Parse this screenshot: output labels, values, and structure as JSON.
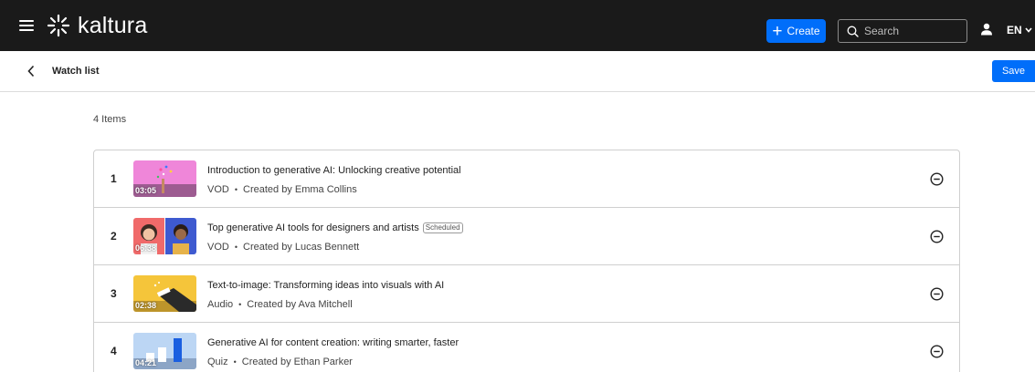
{
  "header": {
    "logo_text": "kaltura",
    "create_label": "Create",
    "search_placeholder": "Search",
    "language": "EN",
    "accent_color": "#006efa",
    "icons": [
      "hamburger-icon",
      "kaltura-logo-icon",
      "plus-icon",
      "search-icon",
      "user-icon",
      "chevron-down-icon"
    ]
  },
  "subheader": {
    "title": "Watch list",
    "save_label": "Save"
  },
  "items_count": "4 Items",
  "items": [
    {
      "number": "1",
      "duration": "03:05",
      "title": "Introduction to generative AI: Unlocking creative potential",
      "badge": "",
      "type": "VOD",
      "created_by": "Created by Emma Collins"
    },
    {
      "number": "2",
      "duration": "06:38",
      "title": "Top generative AI tools for designers and artists",
      "badge": "Scheduled",
      "type": "VOD",
      "created_by": "Created by Lucas Bennett"
    },
    {
      "number": "3",
      "duration": "02:38",
      "title": "Text-to-image: Transforming ideas into visuals with AI",
      "badge": "",
      "type": "Audio",
      "created_by": "Created by Ava Mitchell"
    },
    {
      "number": "4",
      "duration": "04:21",
      "title": "Generative AI for content creation: writing smarter, faster",
      "badge": "",
      "type": "Quiz",
      "created_by": "Created by Ethan Parker"
    }
  ]
}
